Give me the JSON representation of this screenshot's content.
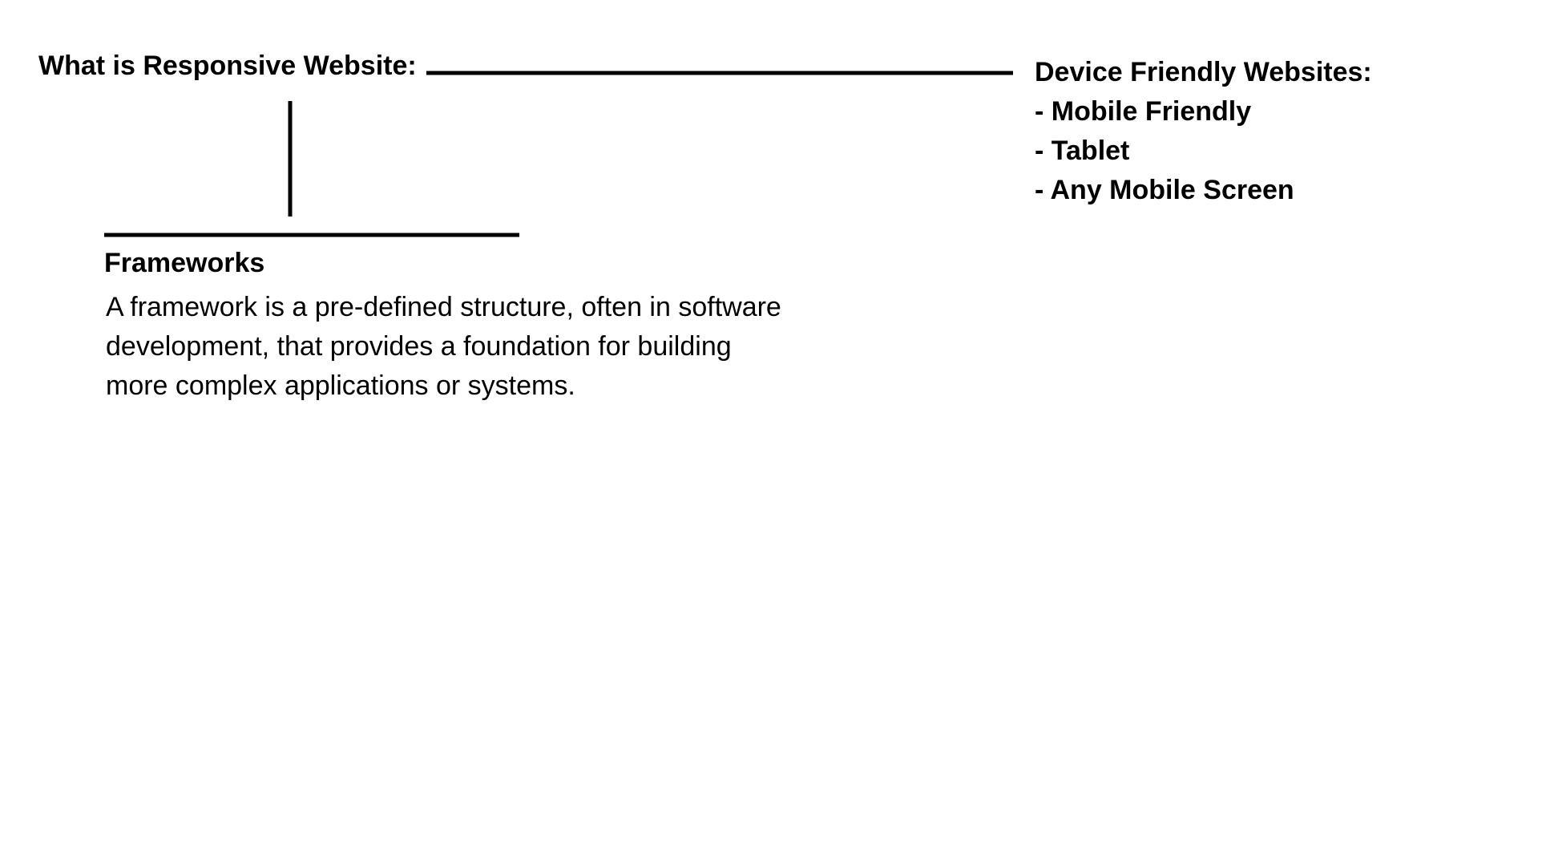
{
  "diagram": {
    "main_title": "What is Responsive Website:",
    "device_section": {
      "heading": "Device Friendly Websites:",
      "items": [
        "- Mobile Friendly",
        "- Tablet",
        "- Any Mobile Screen"
      ]
    },
    "frameworks_section": {
      "heading": "Frameworks",
      "description_lines": [
        "A framework is a pre-defined structure, often in software",
        "development, that provides a foundation for building",
        "more complex applications or systems."
      ]
    },
    "colors": {
      "text": "#000000",
      "line": "#000000",
      "background": "#ffffff"
    }
  }
}
